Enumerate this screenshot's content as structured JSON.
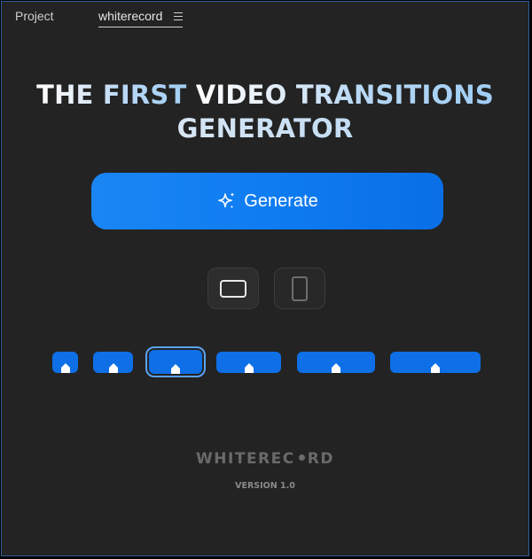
{
  "tabs": {
    "project_label": "Project",
    "active_label": "whiterecord"
  },
  "headline": {
    "line1_part1": "THE FIRST ",
    "line1_part2": "VIDEO TRANSITIONS",
    "line2": "GENERATOR"
  },
  "generate_button": {
    "label": "Generate",
    "icon": "sparkle-icon"
  },
  "orientation": {
    "options": [
      "landscape",
      "portrait"
    ],
    "selected": "landscape"
  },
  "presets": {
    "count": 6,
    "selected_index": 2,
    "icon": "home-icon"
  },
  "branding": {
    "logo_text_left": "WHITEREC",
    "logo_text_right": "RD",
    "version": "VERSION 1.0"
  },
  "colors": {
    "accent": "#0e6fe6",
    "background": "#232323"
  }
}
